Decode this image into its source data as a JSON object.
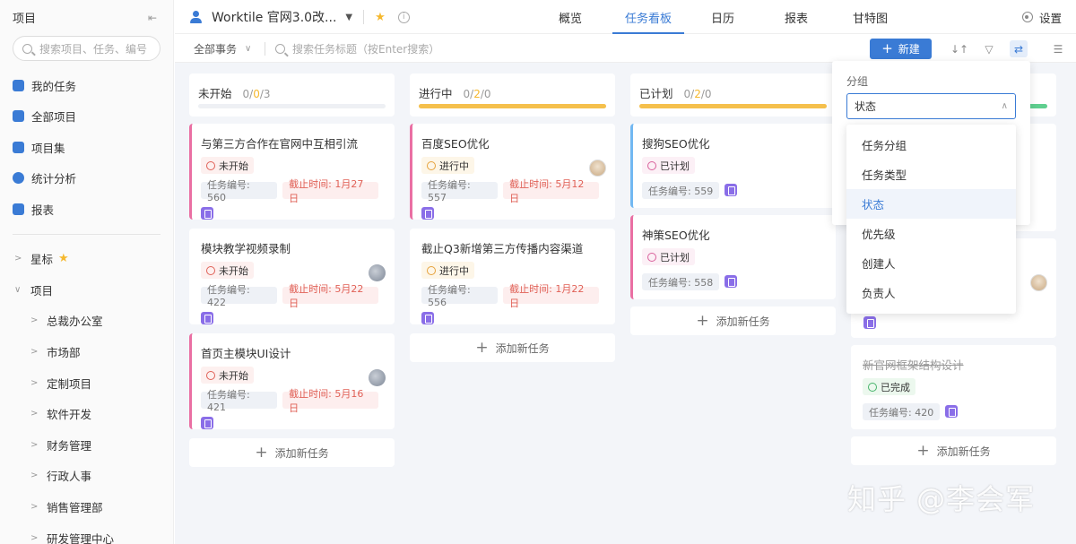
{
  "sidebar": {
    "title": "项目",
    "search_placeholder": "搜索项目、任务、编号",
    "menu": [
      {
        "label": "我的任务",
        "icon": "user-icon"
      },
      {
        "label": "全部项目",
        "icon": "layers-icon"
      },
      {
        "label": "项目集",
        "icon": "list-icon"
      },
      {
        "label": "统计分析",
        "icon": "pie-chart-icon"
      },
      {
        "label": "报表",
        "icon": "bar-chart-icon"
      }
    ],
    "star_label": "星标",
    "projects_label": "项目",
    "projects": [
      "总裁办公室",
      "市场部",
      "定制项目",
      "软件开发",
      "财务管理",
      "行政人事",
      "销售管理部",
      "研发管理中心"
    ]
  },
  "header": {
    "project_title": "Worktile 官网3.0改...",
    "nav": [
      "概览",
      "任务看板",
      "日历",
      "报表",
      "甘特图"
    ],
    "active_nav": "任务看板",
    "settings": "设置"
  },
  "toolbar": {
    "filter": "全部事务",
    "search_placeholder": "搜索任务标题（按Enter搜索）",
    "new_button": "新建"
  },
  "board": {
    "add_task_label": "添加新任务",
    "columns": [
      {
        "title": "未开始",
        "counts": [
          "0",
          "0",
          "3"
        ],
        "progress": 0,
        "cards": [
          {
            "title": "与第三方合作在官网中互相引流",
            "status": "未开始",
            "num": "任务编号: 560",
            "due": "截止时间: 1月27日",
            "avatar": false
          },
          {
            "title": "模块教学视频录制",
            "status": "未开始",
            "num": "任务编号: 422",
            "due": "截止时间: 5月22日",
            "avatar": true
          },
          {
            "title": "首页主模块UI设计",
            "status": "未开始",
            "num": "任务编号: 421",
            "due": "截止时间: 5月16日",
            "avatar": true
          }
        ]
      },
      {
        "title": "进行中",
        "counts": [
          "0",
          "2",
          "0"
        ],
        "progress": 100,
        "cards": [
          {
            "title": "百度SEO优化",
            "status": "进行中",
            "num": "任务编号: 557",
            "due": "截止时间: 5月12日",
            "avatar": true
          },
          {
            "title": "截止Q3新增第三方传播内容渠道",
            "status": "进行中",
            "num": "任务编号: 556",
            "due": "截止时间: 1月22日",
            "avatar": false
          }
        ]
      },
      {
        "title": "已计划",
        "counts": [
          "0",
          "2",
          "0"
        ],
        "progress": 100,
        "cards": [
          {
            "title": "搜狗SEO优化",
            "status": "已计划",
            "num": "任务编号: 559"
          },
          {
            "title": "神策SEO优化",
            "status": "已计划",
            "num": "任务编号: 558"
          }
        ]
      },
      {
        "cards": [
          {
            "title": "新官网框架结构设计",
            "status": "已完成",
            "num": "任务编号: 420"
          }
        ]
      }
    ]
  },
  "group_panel": {
    "label": "分组",
    "selected": "状态",
    "options": [
      "任务分组",
      "任务类型",
      "状态",
      "优先级",
      "创建人",
      "负责人"
    ]
  },
  "watermark": "知乎 @李会军"
}
